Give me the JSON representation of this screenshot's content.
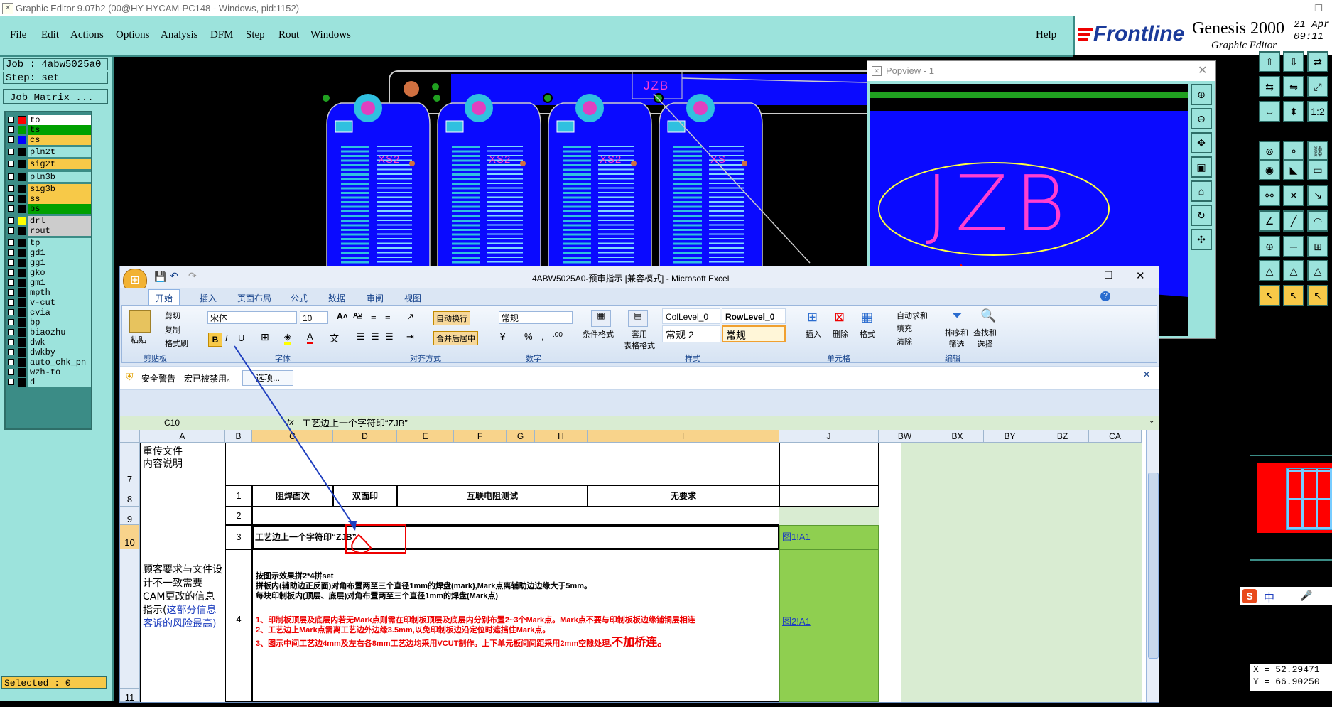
{
  "window": {
    "title": "Graphic Editor 9.07b2 (00@HY-HYCAM-PC148 - Windows, pid:1152)"
  },
  "menu": {
    "items": [
      "File",
      "Edit",
      "Actions",
      "Options",
      "Analysis",
      "DFM",
      "Step",
      "Rout",
      "Windows"
    ],
    "help": "Help"
  },
  "brand": {
    "logo": "Frontline",
    "product": "Genesis 2000",
    "subtitle": "Graphic Editor",
    "date": "21 Apr",
    "time": "09:11"
  },
  "left_panel": {
    "job": "Job : 4abw5025a0",
    "step": "Step: set",
    "matrix_button": "Job Matrix ...",
    "selected": "Selected : 0",
    "layers": [
      {
        "name": "to",
        "swatch": "#ff0000",
        "bg": "#ffffff"
      },
      {
        "name": "ts",
        "swatch": "#00a000",
        "bg": "#00a000"
      },
      {
        "name": "cs",
        "swatch": "#0000ff",
        "bg": "#f7c948"
      },
      {
        "name": "pln2t",
        "swatch": "#000000",
        "bg": "#9ce3dc"
      },
      {
        "name": "sig2t",
        "swatch": "#000000",
        "bg": "#f7c948"
      },
      {
        "name": "pln3b",
        "swatch": "#000000",
        "bg": "#9ce3dc"
      },
      {
        "name": "sig3b",
        "swatch": "#000000",
        "bg": "#f7c948"
      },
      {
        "name": "ss",
        "swatch": "#000000",
        "bg": "#f7c948"
      },
      {
        "name": "bs",
        "swatch": "#000000",
        "bg": "#00a000"
      },
      {
        "name": "drl",
        "swatch": "#ffff00",
        "bg": "#cccccc"
      },
      {
        "name": "rout",
        "swatch": "#000000",
        "bg": "#cccccc"
      },
      {
        "name": "tp",
        "swatch": "#000000",
        "bg": "#9ce3dc"
      },
      {
        "name": "gd1",
        "swatch": "#000000",
        "bg": "#9ce3dc"
      },
      {
        "name": "gg1",
        "swatch": "#000000",
        "bg": "#9ce3dc"
      },
      {
        "name": "gko",
        "swatch": "#000000",
        "bg": "#9ce3dc"
      },
      {
        "name": "gm1",
        "swatch": "#000000",
        "bg": "#9ce3dc"
      },
      {
        "name": "mpth",
        "swatch": "#000000",
        "bg": "#9ce3dc"
      },
      {
        "name": "v-cut",
        "swatch": "#000000",
        "bg": "#9ce3dc"
      },
      {
        "name": "cvia",
        "swatch": "#000000",
        "bg": "#9ce3dc"
      },
      {
        "name": "bp",
        "swatch": "#000000",
        "bg": "#9ce3dc"
      },
      {
        "name": "biaozhu",
        "swatch": "#000000",
        "bg": "#9ce3dc"
      },
      {
        "name": "dwk",
        "swatch": "#000000",
        "bg": "#9ce3dc"
      },
      {
        "name": "dwkby",
        "swatch": "#000000",
        "bg": "#9ce3dc"
      },
      {
        "name": "auto_chk_pn",
        "swatch": "#000000",
        "bg": "#9ce3dc"
      },
      {
        "name": "wzh-to",
        "swatch": "#000000",
        "bg": "#9ce3dc"
      },
      {
        "name": "d",
        "swatch": "#000000",
        "bg": "#9ce3dc"
      }
    ]
  },
  "canvas": {
    "label_box": "JZB",
    "silk": [
      "XS2",
      "XS2",
      "XS2",
      "XS"
    ]
  },
  "popview": {
    "title": "Popview - 1",
    "text": "JZB"
  },
  "coords": {
    "x": "X = 52.29471",
    "y": "Y = 66.90250"
  },
  "ime": {
    "label": "中"
  },
  "excel": {
    "title": "4ABW5025A0-预审指示 [兼容模式] - Microsoft Excel",
    "tabs": [
      "开始",
      "插入",
      "页面布局",
      "公式",
      "数据",
      "审阅",
      "视图"
    ],
    "clipboard": {
      "paste": "粘贴",
      "cut": "剪切",
      "copy": "复制",
      "format_painter": "格式刷",
      "label": "剪贴板"
    },
    "font": {
      "name": "宋体",
      "size": "10",
      "label": "字体"
    },
    "alignment": {
      "wrap": "自动换行",
      "merge": "合并后居中",
      "label": "对齐方式"
    },
    "number": {
      "format": "常规",
      "label": "数字"
    },
    "styles": {
      "cond": "条件格式",
      "table": "套用\n表格格式",
      "s1": "ColLevel_0",
      "s2": "RowLevel_0",
      "s3": "常规 2",
      "s4": "常规",
      "label": "样式"
    },
    "cells": {
      "insert": "插入",
      "delete": "删除",
      "format": "格式",
      "label": "单元格"
    },
    "editing": {
      "autosum": "自动求和",
      "fill": "填充",
      "clear": "清除",
      "sort": "排序和\n筛选",
      "find": "查找和\n选择",
      "label": "编辑"
    },
    "security": {
      "warning": "安全警告",
      "message": "宏已被禁用。",
      "options": "选项..."
    },
    "namebox": "C10",
    "formula": "工艺边上一个字符印“ZJB”",
    "columns": [
      "A",
      "B",
      "C",
      "D",
      "E",
      "F",
      "G",
      "H",
      "I",
      "J",
      "BW",
      "BX",
      "BY",
      "BZ",
      "CA"
    ],
    "rows": [
      "7",
      "8",
      "9",
      "10",
      "",
      "11"
    ],
    "cells_data": {
      "a7": "重传文件\n内容说明",
      "b8": "1",
      "c8": "阻焊面次",
      "d8": "双面印",
      "e8": "互联电阻测试",
      "i8": "无要求",
      "b9": "2",
      "b10": "3",
      "c10": "工艺边上一个字符印“ZJB”",
      "j10": "图1!A1",
      "a_req_black": "顾客要求与文件设计不一致需要CAM更改的信息指示(",
      "a_req_blue": "这部分信息客诉的风险最高)",
      "b11": "4",
      "note1": "按图示效果拼2*4拼set",
      "note2": "拼板内(辅助边正反面)对角布置两至三个直径1mm的焊盘(mark),Mark点离辅助边边缘大于5mm。",
      "note3": "每块印制板内(顶层、底层)对角布置两至三个直径1mm的焊盘(Mark点)",
      "note4": "1、印制板顶层及底层内若无Mark点则需在印制板顶层及底层内分别布置2~3个Mark点。Mark点不要与印制板板边缘铺铜层相连",
      "note5": "2、工艺边上Mark点需离工艺边外边缘3.5mm,以免印制板边沿定位时遮挡住Mark点。",
      "note6a": "3、图示中间工艺边4mm及左右各8mm工艺边均采用VCUT制作。上下单元板间间距采用2mm空隙处理,",
      "note6b": "不加桥连。",
      "j11": "图2!A1"
    }
  }
}
